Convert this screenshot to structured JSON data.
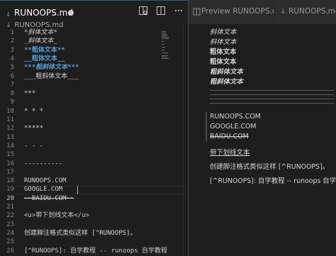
{
  "left_editor": {
    "tab_icon": "↓",
    "tab_title": "RUNOOPS.md",
    "tab_modified_dot": true,
    "toolbar_icons": [
      "open-preview-icon",
      "split-editor-icon",
      "more-actions-icon"
    ],
    "breadcrumb_icon": "↓",
    "breadcrumb": "RUNOOPS.md",
    "current_line": "20",
    "lines": [
      {
        "n": "1",
        "t": "*斜体文本*"
      },
      {
        "n": "2",
        "t": "_斜体文本_"
      },
      {
        "n": "3",
        "t": "**粗体文本**"
      },
      {
        "n": "4",
        "t": "__粗体文本__"
      },
      {
        "n": "5",
        "t": "***粗斜体文本***"
      },
      {
        "n": "6",
        "t": "___粗斜体文本___"
      },
      {
        "n": "7",
        "t": ""
      },
      {
        "n": "8",
        "t": "***"
      },
      {
        "n": "9",
        "t": ""
      },
      {
        "n": "10",
        "t": "* * *"
      },
      {
        "n": "11",
        "t": ""
      },
      {
        "n": "12",
        "t": "*****"
      },
      {
        "n": "13",
        "t": ""
      },
      {
        "n": "14",
        "t": "- - -"
      },
      {
        "n": "15",
        "t": ""
      },
      {
        "n": "16",
        "t": "----------"
      },
      {
        "n": "17",
        "t": ""
      },
      {
        "n": "18",
        "t": "RUNOOPS.COM"
      },
      {
        "n": "19",
        "t": "GOOGLE.COM"
      },
      {
        "n": "20",
        "t": "~~BAIDU.COM~~"
      },
      {
        "n": "21",
        "t": ""
      },
      {
        "n": "22",
        "t": "<u>带下划线文本</u>"
      },
      {
        "n": "23",
        "t": ""
      },
      {
        "n": "24",
        "t": "创建脚注格式类似这样 [^RUNOOPS]。"
      },
      {
        "n": "25",
        "t": ""
      },
      {
        "n": "26",
        "t": "[^RUNOOPS]: 自学教程 -- runoops 自学教程"
      }
    ]
  },
  "right_pane": {
    "tab1_icon": "preview-icon",
    "tab1_title": "Preview RUNOOPS.md",
    "tab2_icon": "↓",
    "tab2_title": "RUNOOPS.md",
    "preview": {
      "italic1": "斜体文本",
      "italic2": "斜体文本",
      "bold1": "粗体文本",
      "bold2": "粗体文本",
      "bolditalic1": "粗斜体文本",
      "bolditalic2": "粗斜体文本",
      "quote": [
        "RUNOOPS.COM",
        "GOOGLE.COM",
        "BAIDU.COM"
      ],
      "underline": "带下划线文本",
      "footnote_ref": "创建脚注格式类似这样 [^RUNOOPS]。",
      "footnote_def": "[^RUNOOPS]: 自学教程 -- runoops 自学教程"
    }
  }
}
